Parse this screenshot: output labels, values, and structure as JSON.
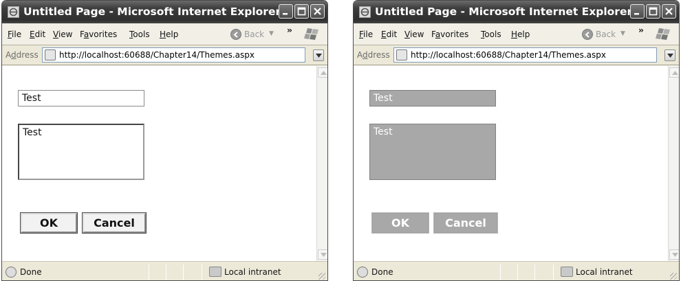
{
  "windows": [
    {
      "title": "Untitled Page - Microsoft Internet Explorer",
      "menu": {
        "file": {
          "u": "F",
          "rest": "ile"
        },
        "edit": {
          "u": "E",
          "rest": "dit"
        },
        "view": {
          "u": "V",
          "rest": "iew"
        },
        "favorites": {
          "pre": "F",
          "u": "a",
          "rest": "vorites"
        },
        "tools": {
          "u": "T",
          "rest": "ools"
        },
        "help": {
          "u": "H",
          "rest": "elp"
        }
      },
      "back_label": "Back",
      "address": {
        "pre": "A",
        "u": "d",
        "rest": "dress",
        "url": "http://localhost:60688/Chapter14/Themes.aspx"
      },
      "form": {
        "textbox_value": "Test",
        "textarea_value": "Test",
        "ok_label": "OK",
        "cancel_label": "Cancel"
      },
      "status": {
        "text": "Done",
        "zone": "Local intranet"
      }
    },
    {
      "title": "Untitled Page - Microsoft Internet Explorer",
      "menu": {
        "file": {
          "u": "F",
          "rest": "ile"
        },
        "edit": {
          "u": "E",
          "rest": "dit"
        },
        "view": {
          "u": "V",
          "rest": "iew"
        },
        "favorites": {
          "pre": "F",
          "u": "a",
          "rest": "vorites"
        },
        "tools": {
          "u": "T",
          "rest": "ools"
        },
        "help": {
          "u": "H",
          "rest": "elp"
        }
      },
      "back_label": "Back",
      "address": {
        "pre": "A",
        "u": "d",
        "rest": "dress",
        "url": "http://localhost:60688/Chapter14/Themes.aspx"
      },
      "form": {
        "textbox_value": "Test",
        "textarea_value": "Test",
        "ok_label": "OK",
        "cancel_label": "Cancel"
      },
      "status": {
        "text": "Done",
        "zone": "Local intranet"
      }
    }
  ],
  "colors": {
    "titlebar": "#3c3c3c",
    "chrome": "#ece9d8",
    "themed_control_fill": "#a8a8a8",
    "themed_control_text": "#ffffff"
  },
  "icons": [
    "ie-page-icon",
    "minimize-icon",
    "maximize-icon",
    "close-icon",
    "back-arrow-icon",
    "windows-logo-icon",
    "dropdown-arrow-icon",
    "scroll-up-icon",
    "scroll-down-icon",
    "ie-done-icon",
    "local-intranet-icon"
  ]
}
